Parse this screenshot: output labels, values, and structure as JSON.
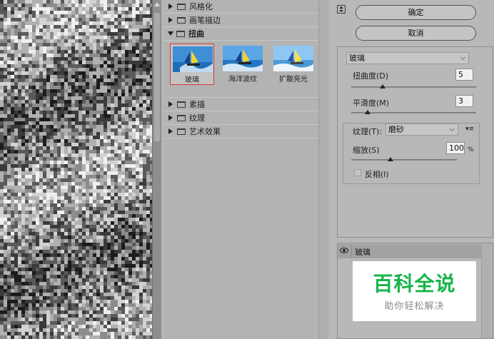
{
  "gallery": {
    "categories": [
      {
        "label": "风格化",
        "expanded": false
      },
      {
        "label": "画笔描边",
        "expanded": false
      },
      {
        "label": "扭曲",
        "expanded": true
      },
      {
        "label": "素描",
        "expanded": false
      },
      {
        "label": "纹理",
        "expanded": false
      },
      {
        "label": "艺术效果",
        "expanded": false
      }
    ],
    "filters": [
      {
        "label": "玻璃",
        "selected": true
      },
      {
        "label": "海洋波纹",
        "selected": false
      },
      {
        "label": "扩散亮光",
        "selected": false
      }
    ]
  },
  "actions": {
    "ok_label": "确定",
    "cancel_label": "取消"
  },
  "settings": {
    "filter_name": "玻璃",
    "distortion_label": "扭曲度(D)",
    "distortion_value": "5",
    "distortion_level": 0.25,
    "smoothness_label": "平滑度(M)",
    "smoothness_value": "3",
    "smoothness_level": 0.13,
    "texture_label": "纹理(T):",
    "texture_value": "磨砂",
    "scaling_label": "缩放(S)",
    "scaling_value": "100",
    "scaling_unit": "%",
    "scaling_level": 0.37,
    "invert_label": "反相(I)",
    "invert_checked": false
  },
  "layers": {
    "items": [
      {
        "label": "玻璃"
      }
    ]
  },
  "watermark": {
    "main": "百科全说",
    "sub": "助你轻松解决"
  },
  "colors": {
    "selection_border": "#d23a3a",
    "watermark_green": "#16b54a"
  }
}
